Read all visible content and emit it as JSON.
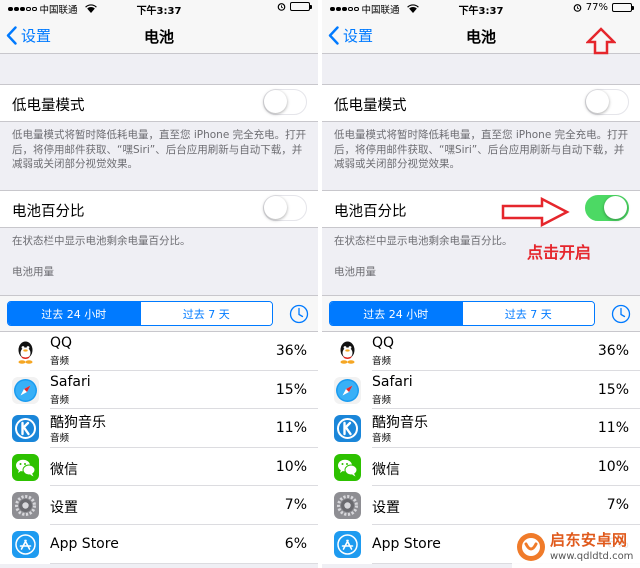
{
  "status_bar": {
    "carrier": "中国联通",
    "time": "下午3:37",
    "battery_percent_label": "77%",
    "battery_level": 0.77
  },
  "nav": {
    "back_label": "设置",
    "title": "电池"
  },
  "low_power": {
    "label": "低电量模式",
    "enabled": false,
    "footer": "低电量模式将暂时降低耗电量，直至您 iPhone 完全充电。打开后，将停用邮件获取、“嘿Siri”、后台应用刷新与自动下载，并减弱或关闭部分视觉效果。"
  },
  "battery_percentage": {
    "label": "电池百分比",
    "enabled_before": false,
    "enabled_after": true,
    "footer": "在状态栏中显示电池剩余电量百分比。"
  },
  "usage": {
    "header": "电池用量",
    "tabs": [
      "过去 24 小时",
      "过去 7 天"
    ],
    "selected_tab": 0,
    "apps": [
      {
        "name": "QQ",
        "subtitle": "音频",
        "percent": "36%",
        "icon": "qq-icon"
      },
      {
        "name": "Safari",
        "subtitle": "音频",
        "percent": "15%",
        "icon": "safari-icon"
      },
      {
        "name": "酷狗音乐",
        "subtitle": "音频",
        "percent": "11%",
        "icon": "kugou-icon"
      },
      {
        "name": "微信",
        "subtitle": "",
        "percent": "10%",
        "icon": "wechat-icon"
      },
      {
        "name": "设置",
        "subtitle": "",
        "percent": "7%",
        "icon": "settings-icon"
      },
      {
        "name": "App Store",
        "subtitle": "",
        "percent": "6%",
        "icon": "app-store-icon"
      }
    ]
  },
  "annotation": {
    "label": "点击开启",
    "color": "#e5262c"
  },
  "watermark": {
    "title": "启东安卓网",
    "url": "www.qdldtd.com"
  },
  "colors": {
    "accent": "#007aff",
    "toggle_on": "#4cd964",
    "background": "#efeff4"
  }
}
